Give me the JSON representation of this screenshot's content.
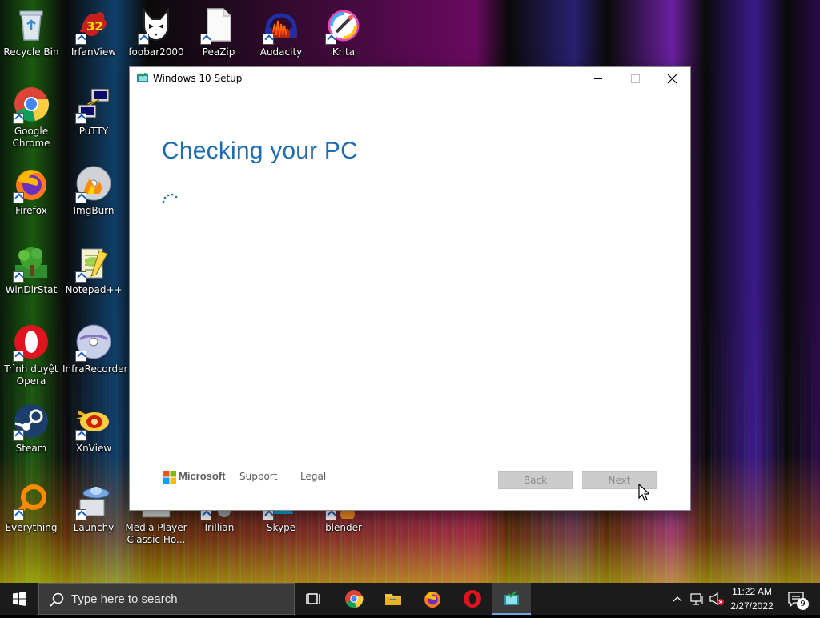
{
  "desktop": {
    "icons": [
      {
        "label": "Recycle Bin",
        "icon": "recycle-bin-icon"
      },
      {
        "label": "IrfanView",
        "icon": "irfanview-icon"
      },
      {
        "label": "foobar2000",
        "icon": "foobar2000-icon"
      },
      {
        "label": "PeaZip",
        "icon": "peazip-icon"
      },
      {
        "label": "Audacity",
        "icon": "audacity-icon"
      },
      {
        "label": "Krita",
        "icon": "krita-icon"
      },
      {
        "label": "Google Chrome",
        "icon": "chrome-icon"
      },
      {
        "label": "PuTTY",
        "icon": "putty-icon"
      },
      {
        "label": "Firefox",
        "icon": "firefox-icon"
      },
      {
        "label": "ImgBurn",
        "icon": "imgburn-icon"
      },
      {
        "label": "WinDirStat",
        "icon": "windirstat-icon"
      },
      {
        "label": "Notepad++",
        "icon": "notepadpp-icon"
      },
      {
        "label": "Trình duyệt Opera",
        "icon": "opera-icon"
      },
      {
        "label": "InfraRecorder",
        "icon": "infrarecorder-icon"
      },
      {
        "label": "Steam",
        "icon": "steam-icon"
      },
      {
        "label": "XnView",
        "icon": "xnview-icon"
      },
      {
        "label": "Everything",
        "icon": "everything-icon"
      },
      {
        "label": "Launchy",
        "icon": "launchy-icon"
      },
      {
        "label": "Media Player Classic Ho...",
        "icon": "mpc-hc-icon"
      },
      {
        "label": "Trillian",
        "icon": "trillian-icon"
      },
      {
        "label": "Skype",
        "icon": "skype-icon"
      },
      {
        "label": "blender",
        "icon": "blender-icon"
      }
    ]
  },
  "setup_window": {
    "title": "Windows 10 Setup",
    "heading": "Checking your PC",
    "footer": {
      "brand": "Microsoft",
      "support": "Support",
      "legal": "Legal",
      "back_label": "Back",
      "next_label": "Next"
    },
    "accent_color": "#1f6cb0"
  },
  "taskbar": {
    "search_placeholder": "Type here to search",
    "pinned": [
      "task-view-icon",
      "chrome-icon",
      "file-explorer-icon",
      "firefox-icon",
      "opera-icon",
      "windows-setup-icon"
    ],
    "time": "11:22 AM",
    "date": "2/27/2022",
    "notification_count": "9"
  }
}
